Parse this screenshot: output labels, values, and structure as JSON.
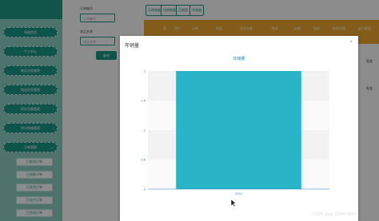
{
  "sidebar": {
    "items": [
      {
        "label": "系统首页",
        "arrow": ""
      },
      {
        "label": "个人中心",
        "arrow": "›"
      },
      {
        "label": "商品分类管理",
        "arrow": "›"
      },
      {
        "label": "商品信息管理",
        "arrow": "›"
      },
      {
        "label": "积分兑换管理",
        "arrow": "›"
      },
      {
        "label": "积分商城管理",
        "arrow": "›"
      },
      {
        "label": "订单管理",
        "arrow": "⌄"
      }
    ],
    "subitems": [
      "已取消订单",
      "已退款订单",
      "已发货订单",
      "已支付订单",
      "已完成订单"
    ]
  },
  "form": {
    "order_label": "订单编号",
    "order_placeholder": "订单编号",
    "product_label": "商品名称",
    "product_placeholder": "商品名称",
    "query_label": "查询"
  },
  "toolbar": {
    "buttons": [
      "月销售额",
      "年销售额",
      "月销量",
      "年销量"
    ]
  },
  "table": {
    "headers": [
      "索",
      "用户",
      "订单",
      "商品",
      "商品名称",
      "购买",
      "价格",
      "总价",
      "折扣价格",
      "支付类型"
    ],
    "row_values": [
      "现金",
      "现金"
    ]
  },
  "modal": {
    "title": "年销量",
    "close": "×"
  },
  "chart_data": {
    "type": "bar",
    "title": "年销量",
    "categories": [
      "2021"
    ],
    "values": [
      2
    ],
    "ylim": [
      0,
      2
    ],
    "yticks": [
      "0",
      "0.5",
      "1",
      "1.5",
      "2"
    ],
    "xlabel": "",
    "ylabel": "",
    "bar_color": "#29b4c8",
    "grid": true
  },
  "watermark": "CSDN @qq_3166078367"
}
